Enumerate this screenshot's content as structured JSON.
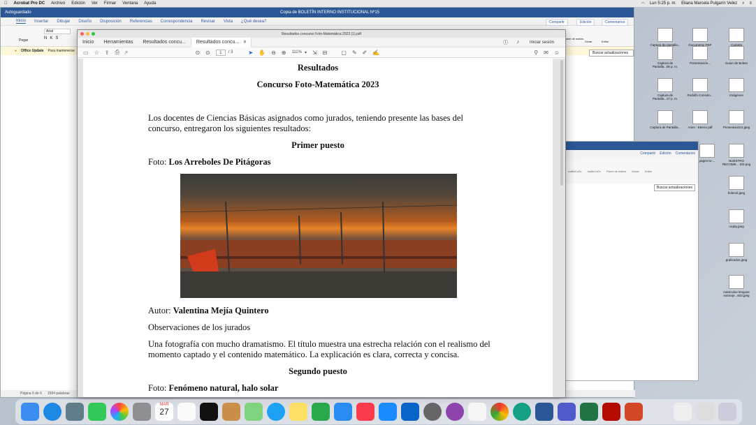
{
  "menubar": {
    "apple": "",
    "app": "Acrobat Pro DC",
    "items": [
      "Archivo",
      "Edición",
      "Ver",
      "Firmar",
      "Ventana",
      "Ayuda"
    ],
    "clock": "Lun 5:25 p. m.",
    "user": "Eliana Marcela Pulgarín Velez"
  },
  "word": {
    "title": "Copia de BOLETÍN INTERNO INSTITUCIONAL Nº15",
    "autosave": "Autoguardado",
    "tabs": [
      "Inicio",
      "Insertar",
      "Dibujar",
      "Diseño",
      "Disposición",
      "Referencias",
      "Correspondencia",
      "Revisar",
      "Vista",
      "¿Qué desea?"
    ],
    "share": "Compartir",
    "edit": "Edición",
    "comments": "Comentarios",
    "paste": "Pegar",
    "font": "Arial",
    "update_label": "Office Update",
    "update_text": "Para mantenerse",
    "find_updates": "Buscar actualizaciones",
    "dictate": "Dictar",
    "editor": "Editor",
    "panel": "Panel de estilos",
    "status_page": "Página 6 de 6",
    "status_words": "1584 palabras"
  },
  "word2": {
    "share": "Compartir",
    "edit": "Edición",
    "comments": "Comentarios",
    "find_updates": "Buscar actualizaciones",
    "style1": "AaBbCcDc",
    "style2": "AaBbCcDc",
    "dictate": "Dictar",
    "editor": "Editor",
    "panel": "Panel de estilos"
  },
  "acrobat": {
    "title": "Resultados concurso Foto-Matemática 2023 (1).pdf",
    "tabs": [
      "Inicio",
      "Herramientas",
      "Resultados concu...",
      "Resultados concu..."
    ],
    "login": "Iniciar sesión",
    "page_current": "1",
    "page_total": "/ 3",
    "zoom": "111%"
  },
  "document": {
    "heading": "Resultados",
    "subheading": "Concurso Foto-Matemática 2023",
    "intro": "Los docentes de Ciencias Básicas asignados como jurados, teniendo presente las bases del concurso, entregaron los siguientes resultados:",
    "first": "Primer puesto",
    "photo_label": "Foto: ",
    "photo_title": "Los Arreboles De Pitágoras",
    "author_label": "Autor: ",
    "author": "Valentina Mejía Quintero",
    "observations": "Observaciones de los jurados",
    "comment": "Una fotografía con mucho dramatismo. El título muestra una estrecha relación con el realismo del momento captado y el contenido matemático. La explicación es clara, correcta y concisa.",
    "second": "Segundo puesto",
    "photo2_label": "Foto: ",
    "photo2_title": "Fenómeno natural, halo solar"
  },
  "desktop_icons": [
    "Captura de pantalla...",
    "Documento PDF",
    "Carpeta",
    "Captura de Pantalla...06 p. m.",
    "Presentación...",
    "Guion de Boleto",
    "Captura de Pantalla...17 p. m.",
    "Rodolfo Consolo...",
    "Imágenes",
    "Captura de Pantalla...",
    "Aries - Eterno.pdf",
    "Presentación1.jpeg",
    "pages-to-...",
    "NUESTRO RECOME... DO.png",
    "boleroil.jpeg",
    "roqkiy.jpeg",
    "graficados.jpeg",
    "matriculas lenguas extranje...923.jpeg"
  ],
  "dock": {
    "calendar_month": "MAR",
    "calendar_day": "27"
  }
}
